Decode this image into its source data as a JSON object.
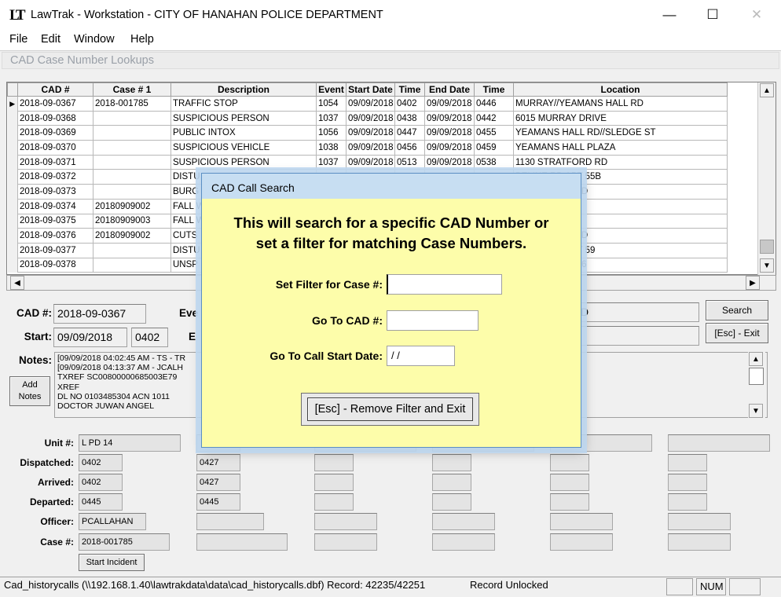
{
  "window": {
    "logo": "LT",
    "title": "LawTrak - Workstation - CITY OF HANAHAN POLICE DEPARTMENT",
    "controls": [
      "—",
      "☐",
      "✕"
    ]
  },
  "menu": [
    "File",
    "Edit",
    "Window",
    "Help"
  ],
  "child_window": {
    "title": "CAD Case Number Lookups"
  },
  "grid": {
    "columns": [
      "CAD #",
      "Case # 1",
      "Description",
      "Event",
      "Start Date",
      "Time",
      "End Date",
      "Time",
      "Location"
    ],
    "rows": [
      [
        "2018-09-0367",
        "2018-001785",
        "TRAFFIC STOP",
        "1054",
        "09/09/2018",
        "0402",
        "09/09/2018",
        "0446",
        "MURRAY//YEAMANS HALL RD"
      ],
      [
        "2018-09-0368",
        "",
        "SUSPICIOUS PERSON",
        "1037",
        "09/09/2018",
        "0438",
        "09/09/2018",
        "0442",
        "6015 MURRAY DRIVE"
      ],
      [
        "2018-09-0369",
        "",
        "PUBLIC INTOX",
        "1056",
        "09/09/2018",
        "0447",
        "09/09/2018",
        "0455",
        "YEAMANS HALL RD//SLEDGE ST"
      ],
      [
        "2018-09-0370",
        "",
        "SUSPICIOUS VEHICLE",
        "1038",
        "09/09/2018",
        "0456",
        "09/09/2018",
        "0459",
        "YEAMANS HALL PLAZA"
      ],
      [
        "2018-09-0371",
        "",
        "SUSPICIOUS PERSON",
        "1037",
        "09/09/2018",
        "0513",
        "09/09/2018",
        "0538",
        "1130 STRATFORD RD"
      ],
      [
        "2018-09-0372",
        "",
        "DISTU",
        "",
        "",
        "",
        "",
        "",
        "BELINE RD APT 55B"
      ],
      [
        "2018-09-0373",
        "",
        "BURG",
        "",
        "",
        "",
        "",
        "",
        "AMANS HALL RD"
      ],
      [
        "2018-09-0374",
        "20180909002",
        "FALL W",
        "",
        "",
        "",
        "",
        "",
        "BLE LANDING"
      ],
      [
        "2018-09-0375",
        "20180909003",
        "FALL W",
        "",
        "",
        "",
        "",
        "",
        "WART ST"
      ],
      [
        "2018-09-0376",
        "20180909002",
        "CUTS",
        "",
        "",
        "",
        "",
        "",
        "AMANS HALL RD"
      ],
      [
        "2018-09-0377",
        "",
        "DISTU",
        "",
        "",
        "",
        "",
        "",
        "BELINE DR APT 59"
      ],
      [
        "2018-09-0378",
        "",
        "UNSP",
        "",
        "",
        "",
        "",
        "",
        "D POINT RD C16"
      ]
    ]
  },
  "detail": {
    "cad_label": "CAD #:",
    "cad_value": "2018-09-0367",
    "event_label": "Eve",
    "start_label": "Start:",
    "start_date": "09/09/2018",
    "start_time": "0402",
    "end_label": "E",
    "right_field_1": "D",
    "search_button": "Search",
    "exit_button": "[Esc] - Exit",
    "notes_label": "Notes:",
    "add_notes_button": "Add Notes",
    "notes_lines": [
      "[09/09/2018 04:02:45 AM - TS - TR",
      "[09/09/2018 04:13:37 AM - JCALH",
      "TXREF SC00800000685003E79",
      "XREF",
      "DL NO 0103485304     ACN  1011",
      "DOCTOR  JUWAN ANGEL"
    ]
  },
  "units": {
    "labels": [
      "Unit #:",
      "Dispatched:",
      "Arrived:",
      "Departed:",
      "Officer:",
      "Case #:"
    ],
    "col1": [
      "L PD  14",
      "0402",
      "0402",
      "0445",
      "PCALLAHAN",
      "2018-001785"
    ],
    "col2": [
      "",
      "0427",
      "0427",
      "0445",
      "",
      ""
    ],
    "start_incident_button": "Start Incident"
  },
  "status": {
    "text": "Cad_historycalls (\\\\192.168.1.40\\lawtrakdata\\data\\cad_historycalls.dbf) Record: 42235/42251",
    "lock": "Record Unlocked",
    "num": "NUM"
  },
  "dialog": {
    "title": "CAD Call Search",
    "heading_1": "This will search for a specific CAD Number or",
    "heading_2": "set a filter for matching Case Numbers.",
    "filter_label": "Set Filter for Case #:",
    "filter_value": "",
    "goto_cad_label": "Go To CAD #:",
    "goto_cad_value": "",
    "goto_date_label": "Go To Call Start Date:",
    "goto_date_value": " / /",
    "remove_button": "[Esc] - Remove Filter and Exit"
  }
}
